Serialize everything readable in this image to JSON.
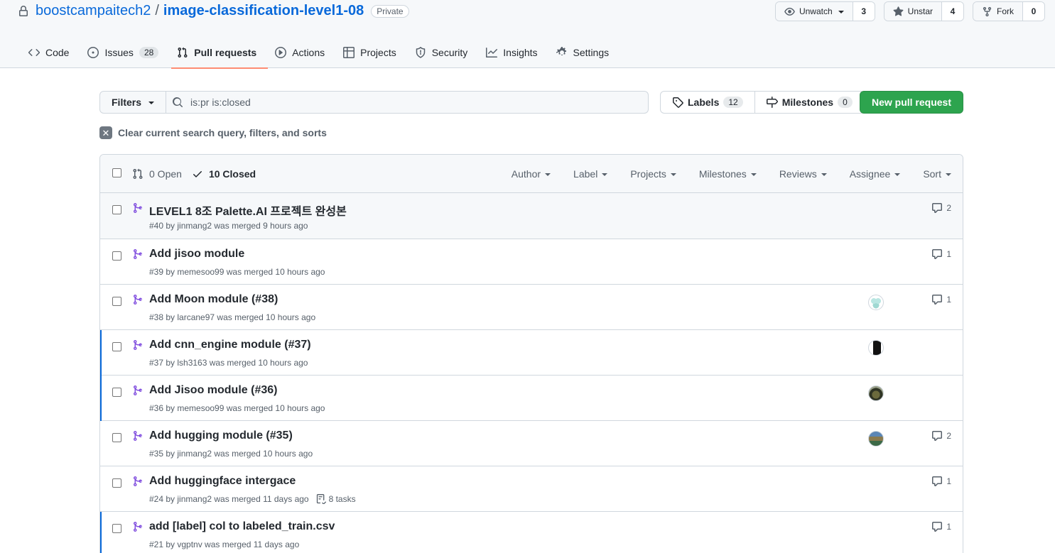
{
  "repo": {
    "owner": "boostcampaitech2",
    "separator": "/",
    "name": "image-classification-level1-08",
    "visibility": "Private",
    "watch": {
      "label": "Unwatch",
      "count": "3"
    },
    "star": {
      "label": "Unstar",
      "count": "4"
    },
    "fork": {
      "label": "Fork",
      "count": "0"
    }
  },
  "tabs": [
    {
      "label": "Code",
      "icon": "code-icon"
    },
    {
      "label": "Issues",
      "icon": "issue-opened-icon",
      "counter": "28"
    },
    {
      "label": "Pull requests",
      "icon": "git-pull-request-icon",
      "selected": true
    },
    {
      "label": "Actions",
      "icon": "play-icon"
    },
    {
      "label": "Projects",
      "icon": "table-icon"
    },
    {
      "label": "Security",
      "icon": "shield-icon"
    },
    {
      "label": "Insights",
      "icon": "graph-icon"
    },
    {
      "label": "Settings",
      "icon": "gear-icon"
    }
  ],
  "subnav": {
    "filters_label": "Filters",
    "search_value": "is:pr is:closed",
    "labels": {
      "label": "Labels",
      "count": "12"
    },
    "milestones": {
      "label": "Milestones",
      "count": "0"
    },
    "new_pr_label": "New pull request"
  },
  "clear_query": "Clear current search query, filters, and sorts",
  "list_header": {
    "open": "0 Open",
    "closed": "10 Closed",
    "filters": [
      "Author",
      "Label",
      "Projects",
      "Milestones",
      "Reviews",
      "Assignee",
      "Sort"
    ]
  },
  "pulls": [
    {
      "title": "LEVEL1 8조 Palette.AI 프로젝트 완성본",
      "meta": "#40 by jinmang2 was merged 9 hours ago",
      "comments": "2"
    },
    {
      "title": "Add jisoo module",
      "meta": "#39 by memesoo99 was merged 10 hours ago",
      "comments": "1"
    },
    {
      "title": "Add Moon module (#38)",
      "meta": "#38 by larcane97 was merged 10 hours ago",
      "comments": "1"
    },
    {
      "title": "Add cnn_engine module (#37)",
      "meta": "#37 by lsh3163 was merged 10 hours ago",
      "comments": ""
    },
    {
      "title": "Add Jisoo module (#36)",
      "meta": "#36 by memesoo99 was merged 10 hours ago",
      "comments": ""
    },
    {
      "title": "Add hugging module (#35)",
      "meta": "#35 by jinmang2 was merged 10 hours ago",
      "comments": "2"
    },
    {
      "title": "Add huggingface intergace",
      "meta": "#24 by jinmang2 was merged 11 days ago",
      "tasks": "8 tasks",
      "comments": "1"
    },
    {
      "title": "add [label] col to labeled_train.csv",
      "meta": "#21 by vgptnv was merged 11 days ago",
      "comments": "1"
    }
  ],
  "colors": {
    "merged": "#8250df",
    "accent": "#0969da",
    "primary_button": "#2da44e",
    "tab_underline": "#fd8c73"
  }
}
